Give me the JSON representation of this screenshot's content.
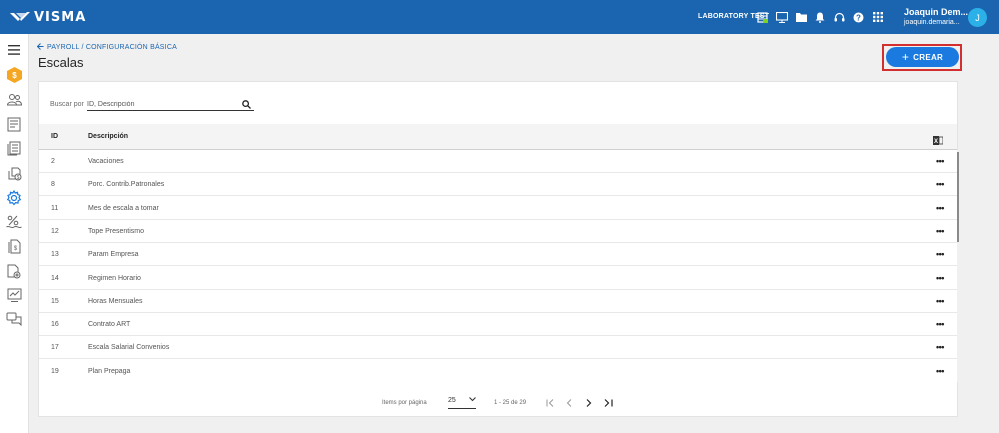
{
  "app": {
    "brand": "VISMA",
    "company": "LABORATORY TEST"
  },
  "user": {
    "name": "Joaquin Dem...",
    "email": "joaquin.demaria...",
    "initial": "J"
  },
  "topbar_icons": [
    "spreadsheet-icon",
    "monitor-icon",
    "folder-icon",
    "bell-icon",
    "headset-icon",
    "help-icon",
    "apps-grid-icon"
  ],
  "sidebar_icons": [
    "menu-icon",
    "payroll-hex-icon",
    "employees-icon",
    "reports-icon",
    "documents-icon",
    "bank-icon",
    "settings-icon",
    "percent-icon",
    "file-icon",
    "file-settings-icon",
    "monitor-chart-icon",
    "chat-icon"
  ],
  "breadcrumb": {
    "text": "PAYROLL / CONFIGURACIÓN BÁSICA"
  },
  "page": {
    "title": "Escalas"
  },
  "actions": {
    "create_label": "CREAR"
  },
  "search": {
    "label": "Buscar por",
    "placeholder": "ID, Descripción"
  },
  "table": {
    "columns": {
      "id": "ID",
      "description": "Descripción"
    },
    "rows": [
      {
        "id": "2",
        "description": "Vacaciones"
      },
      {
        "id": "8",
        "description": "Porc. Contrib.Patronales"
      },
      {
        "id": "11",
        "description": "Mes de escala a tomar"
      },
      {
        "id": "12",
        "description": "Tope Presentismo"
      },
      {
        "id": "13",
        "description": "Param Empresa"
      },
      {
        "id": "14",
        "description": "Regimen Horario"
      },
      {
        "id": "15",
        "description": "Horas Mensuales"
      },
      {
        "id": "16",
        "description": "Contrato ART"
      },
      {
        "id": "17",
        "description": "Escala Salarial Convenios"
      },
      {
        "id": "19",
        "description": "Plan Prepaga"
      }
    ],
    "row_menu": "•••"
  },
  "pagination": {
    "items_label": "Items por página",
    "page_size": "25",
    "range": "1 - 25 de 29"
  },
  "colors": {
    "topbar": "#1b65b0",
    "accent": "#1a7ae0",
    "highlight": "#d32f2f",
    "avatar": "#2bb0e8",
    "hex_badge": "#f5a623"
  }
}
